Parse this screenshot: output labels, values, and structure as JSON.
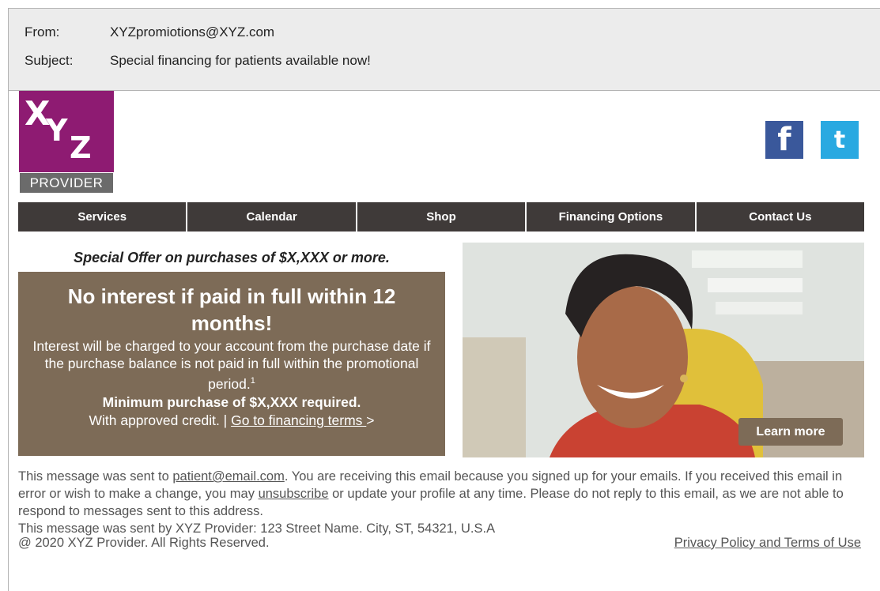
{
  "email": {
    "from_label": "From:",
    "from_value": "XYZpromiotions@XYZ.com",
    "subject_label": "Subject:",
    "subject_value": "Special financing for patients available now!"
  },
  "logo": {
    "letter_x": "X",
    "letter_y": "Y",
    "letter_z": "Z",
    "sublabel": "PROVIDER",
    "brand_color": "#8e1b72"
  },
  "social": {
    "facebook_glyph": "f",
    "twitter_glyph": "t"
  },
  "nav": {
    "items": [
      "Services",
      "Calendar",
      "Shop",
      "Financing Options",
      "Contact Us"
    ]
  },
  "offer": {
    "special": "Special Offer on purchases of $X,XXX or more.",
    "headline": "No interest if paid in full within 12 months!",
    "body": "Interest will be charged to your account from the purchase date if the purchase balance is not paid in full within the promotional period.",
    "footnote_mark": "1",
    "minimum": "Minimum purchase of $X,XXX required.",
    "approved_prefix": "With approved credit. | ",
    "terms_link": "Go to financing terms ",
    "terms_arrow": ">",
    "box_color": "#7d6b57"
  },
  "hero": {
    "learn_more": "Learn more"
  },
  "footer": {
    "sent_to_prefix": "This message was sent to ",
    "sent_to_email": "patient@email.com",
    "sent_to_middle": ". You are receiving this email because you signed up for your emails. If you received this email in error or wish to make a change, you may ",
    "unsubscribe": "unsubscribe",
    "sent_to_suffix": " or update your profile at any time. Please do not reply to this email, as we are not able to respond to messages sent to this address.",
    "sent_by": "This message was sent by XYZ Provider: 123 Street Name. City, ST, 54321, U.S.A",
    "copyright": "@ 2020 XYZ Provider. All Rights Reserved.",
    "privacy": "Privacy Policy and Terms of Use"
  }
}
